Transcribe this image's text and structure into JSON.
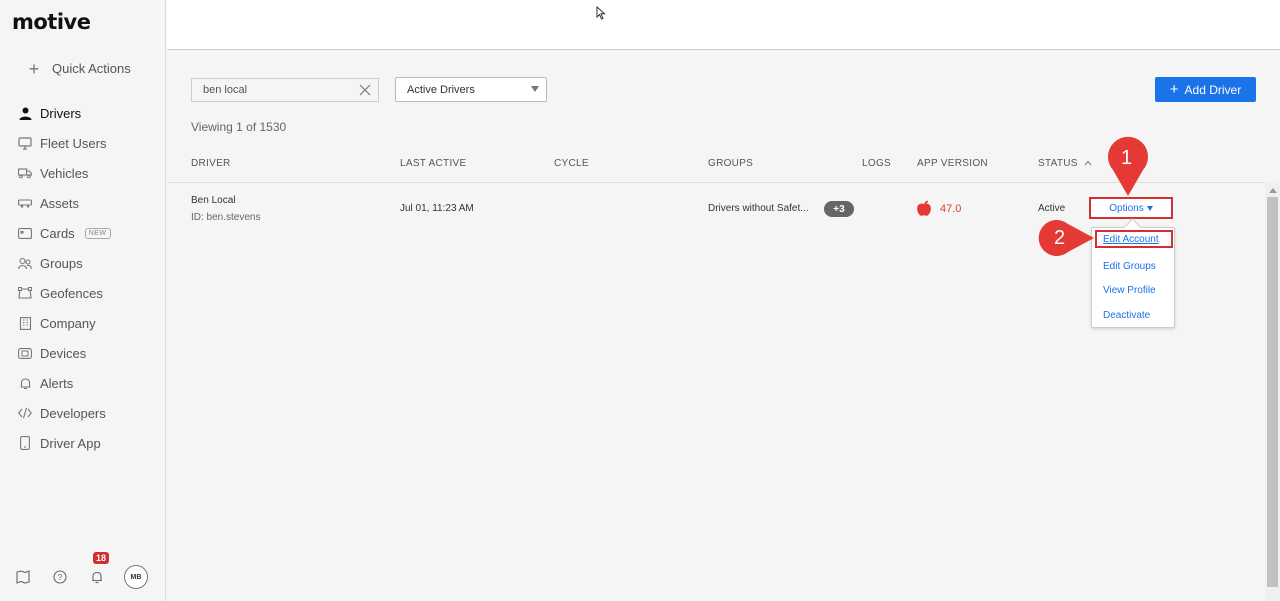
{
  "sidebar": {
    "logo": "motive",
    "quick_actions": "Quick Actions",
    "items": [
      {
        "label": "Drivers",
        "icon": "user-icon",
        "active": true
      },
      {
        "label": "Fleet Users",
        "icon": "monitor-icon"
      },
      {
        "label": "Vehicles",
        "icon": "truck-icon"
      },
      {
        "label": "Assets",
        "icon": "trailer-icon"
      },
      {
        "label": "Cards",
        "icon": "card-icon",
        "badge": "NEW"
      },
      {
        "label": "Groups",
        "icon": "group-icon"
      },
      {
        "label": "Geofences",
        "icon": "geofence-icon"
      },
      {
        "label": "Company",
        "icon": "building-icon"
      },
      {
        "label": "Devices",
        "icon": "device-icon"
      },
      {
        "label": "Alerts",
        "icon": "bell-icon"
      },
      {
        "label": "Developers",
        "icon": "code-icon"
      },
      {
        "label": "Driver App",
        "icon": "phone-icon"
      }
    ],
    "footer": {
      "notification_count": "18",
      "avatar_initials": "MB"
    }
  },
  "toolbar": {
    "search_value": "ben local",
    "filter_selected": "Active Drivers",
    "add_driver_label": "Add Driver"
  },
  "viewing_text": "Viewing 1 of 1530",
  "table": {
    "columns": [
      "DRIVER",
      "LAST ACTIVE",
      "CYCLE",
      "GROUPS",
      "LOGS",
      "APP VERSION",
      "STATUS"
    ],
    "rows": [
      {
        "name": "Ben Local",
        "id": "ID: ben.stevens",
        "last_active": "Jul 01, 11:23 AM",
        "cycle": "",
        "groups": "Drivers without Safet...",
        "groups_more": "+3",
        "app_version": "47.0",
        "status": "Active",
        "options_label": "Options"
      }
    ]
  },
  "options_menu": [
    "Edit Account",
    "Edit Groups",
    "View Profile",
    "Deactivate"
  ],
  "callouts": [
    "1",
    "2"
  ],
  "colors": {
    "accent": "#1a73e8",
    "highlight": "#d32f2f",
    "callout": "#e53935",
    "version": "#e53935"
  }
}
